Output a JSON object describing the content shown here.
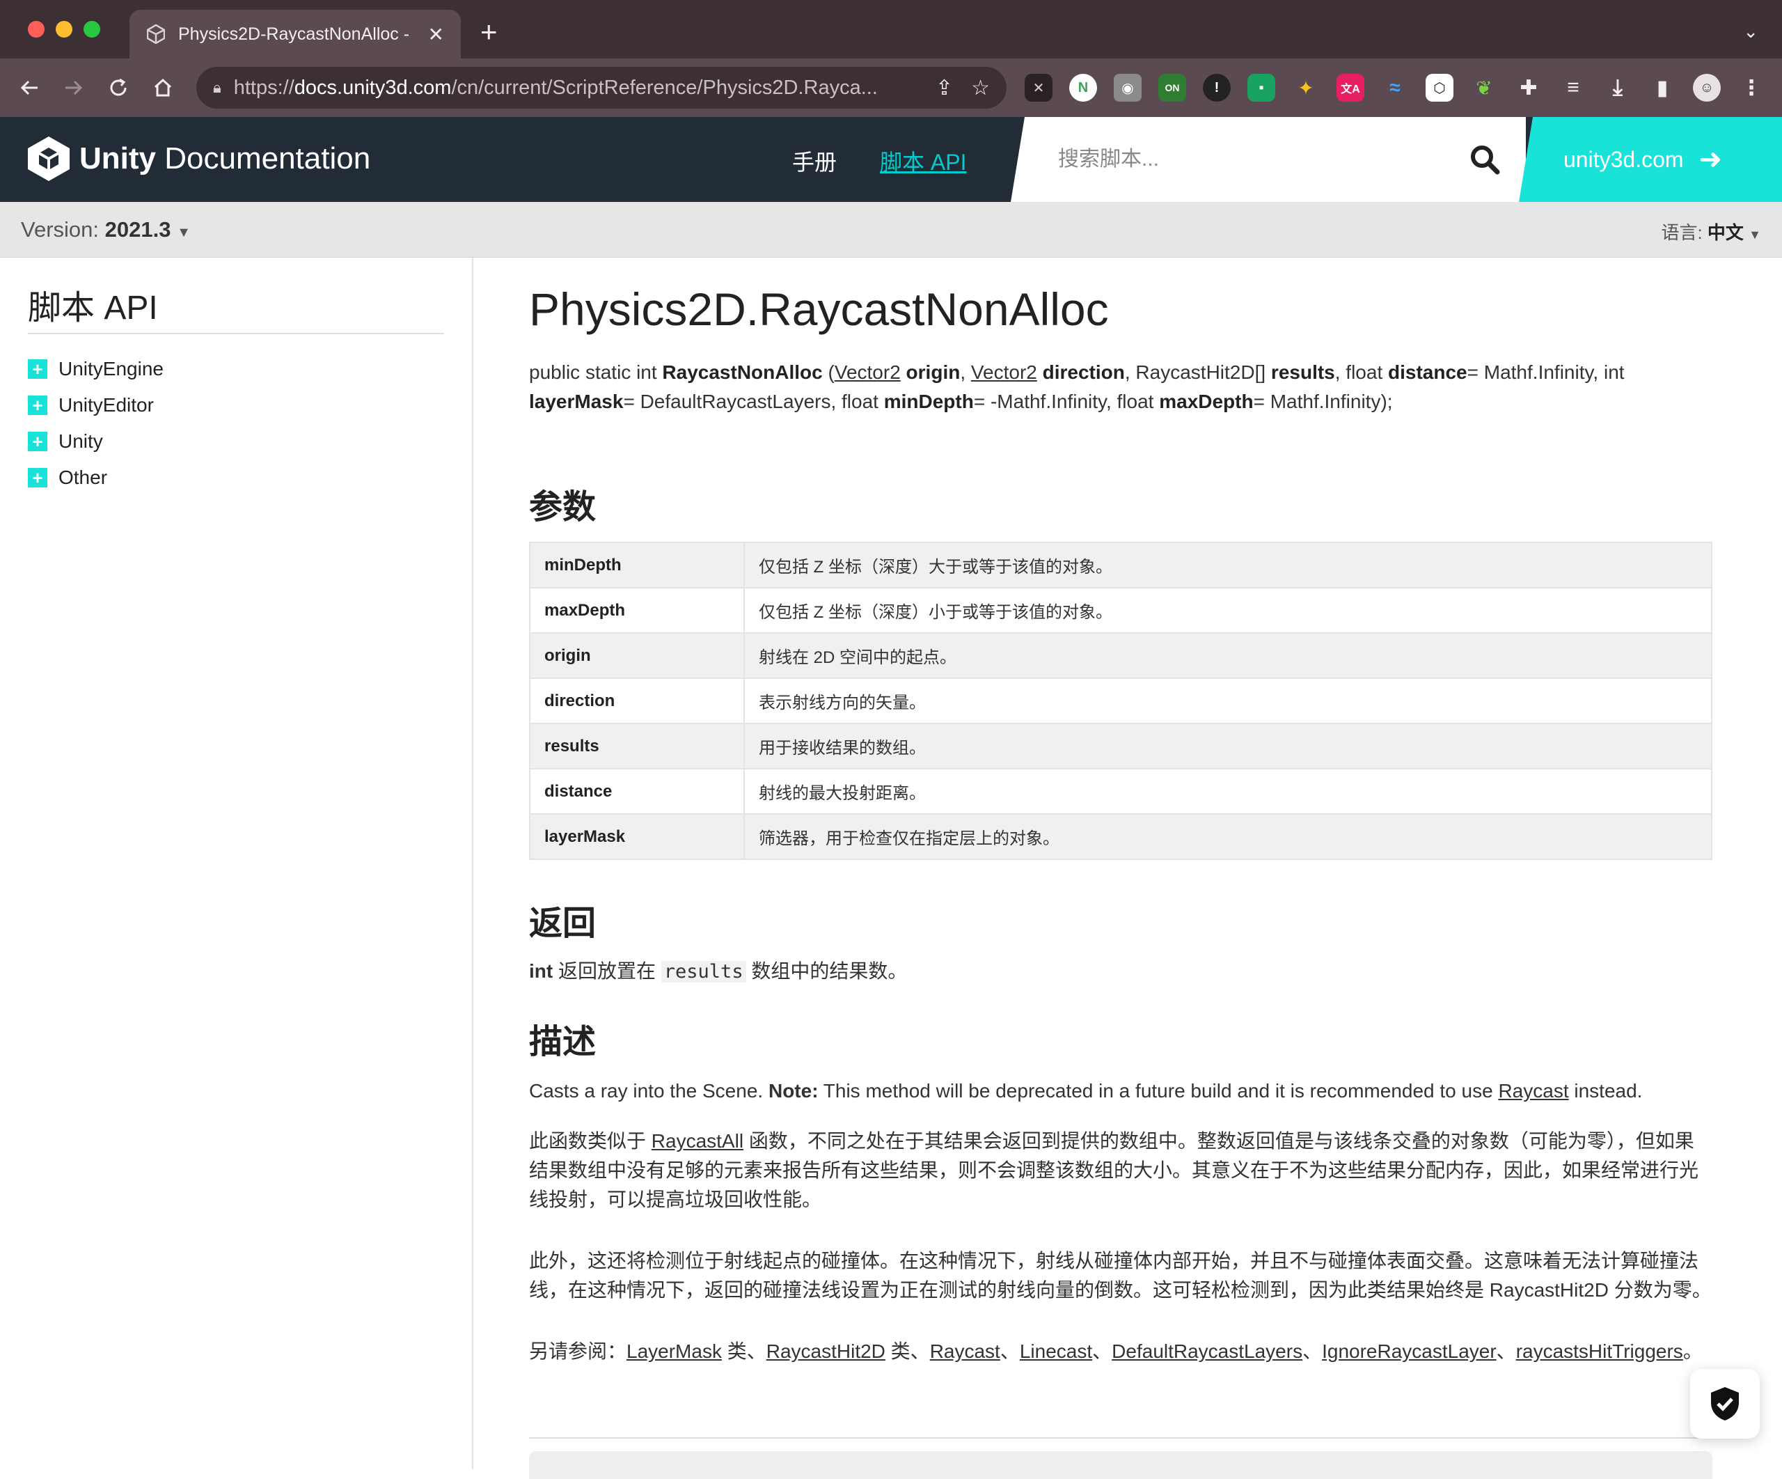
{
  "browser": {
    "tab_title": "Physics2D-RaycastNonAlloc - ",
    "url_prefix": "https://",
    "url_host": "docs.unity3d.com",
    "url_path": "/cn/current/ScriptReference/Physics2D.Rayca..."
  },
  "header": {
    "logo_bold": "Unity",
    "logo_rest": " Documentation",
    "nav_manual": "手册",
    "nav_script_api": "脚本 API",
    "search_placeholder": "搜索脚本...",
    "site_link": "unity3d.com"
  },
  "version_bar": {
    "version_label": "Version: ",
    "version_value": "2021.3",
    "lang_label": "语言: ",
    "lang_value": "中文"
  },
  "sidebar": {
    "title": "脚本 API",
    "items": [
      {
        "label": "UnityEngine"
      },
      {
        "label": "UnityEditor"
      },
      {
        "label": "Unity"
      },
      {
        "label": "Other"
      }
    ]
  },
  "main": {
    "title": "Physics2D.RaycastNonAlloc",
    "signature": {
      "t1": "public static int ",
      "method": "RaycastNonAlloc",
      "t2": " (",
      "type_vector2a": "Vector2",
      "p_origin": " origin",
      "t3": ", ",
      "type_vector2b": "Vector2",
      "p_direction": " direction",
      "t4": ", RaycastHit2D[] ",
      "p_results": "results",
      "t5": ", float ",
      "p_distance": "distance",
      "t6": "= Mathf.Infinity, int ",
      "p_layerMask": "layerMask",
      "t7": "= DefaultRaycastLayers, float ",
      "p_minDepth": "minDepth",
      "t8": "= -Mathf.Infinity, float ",
      "p_maxDepth": "maxDepth",
      "t9": "= Mathf.Infinity);"
    },
    "params_heading": "参数",
    "params": [
      {
        "name": "minDepth",
        "desc": "仅包括 Z 坐标（深度）大于或等于该值的对象。"
      },
      {
        "name": "maxDepth",
        "desc": "仅包括 Z 坐标（深度）小于或等于该值的对象。"
      },
      {
        "name": "origin",
        "desc": "射线在 2D 空间中的起点。"
      },
      {
        "name": "direction",
        "desc": "表示射线方向的矢量。"
      },
      {
        "name": "results",
        "desc": "用于接收结果的数组。"
      },
      {
        "name": "distance",
        "desc": "射线的最大投射距离。"
      },
      {
        "name": "layerMask",
        "desc": "筛选器，用于检查仅在指定层上的对象。"
      }
    ],
    "returns_heading": "返回",
    "returns": {
      "type": "int",
      "pre": " 返回放置在 ",
      "code": "results",
      "post": " 数组中的结果数。"
    },
    "desc_heading": "描述",
    "desc1": {
      "pre": "Casts a ray into the Scene. ",
      "note": "Note:",
      "mid": " This method will be deprecated in a future build and it is recommended to use ",
      "link": "Raycast",
      "post": " instead."
    },
    "desc2": {
      "pre": "此函数类似于 ",
      "link": "RaycastAll",
      "post": " 函数，不同之处在于其结果会返回到提供的数组中。整数返回值是与该线条交叠的对象数（可能为零），但如果结果数组中没有足够的元素来报告所有这些结果，则不会调整该数组的大小。其意义在于不为这些结果分配内存，因此，如果经常进行光线投射，可以提高垃圾回收性能。"
    },
    "desc3": "此外，这还将检测位于射线起点的碰撞体。在这种情况下，射线从碰撞体内部开始，并且不与碰撞体表面交叠。这意味着无法计算碰撞法线，在这种情况下，返回的碰撞法线设置为正在测试的射线向量的倒数。这可轻松检测到，因为此类结果始终是 RaycastHit2D 分数为零。",
    "see_also": {
      "label": "另请参阅：",
      "l1": "LayerMask",
      "s1": " 类、",
      "l2": "RaycastHit2D",
      "s2": " 类、",
      "l3": "Raycast",
      "s3": "、",
      "l4": "Linecast",
      "s4": "、",
      "l5": "DefaultRaycastLayers",
      "s5": "、",
      "l6": "IgnoreRaycastLayer",
      "s6": "、",
      "l7": "raycastsHitTriggers",
      "s7": "。"
    }
  },
  "colors": {
    "header_bg": "#222c37",
    "accent": "#19e3d9",
    "link_active": "#00cccc"
  }
}
